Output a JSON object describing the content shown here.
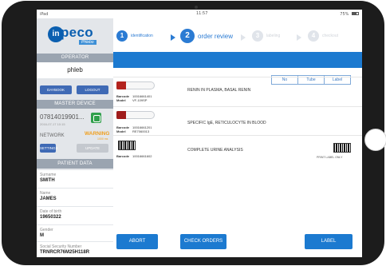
{
  "status_bar": {
    "carrier": "iPad",
    "time": "11:57",
    "battery": "75%"
  },
  "brand": {
    "logo_mark": "in",
    "logo_word": "peco",
    "logo_sub": "Phlebo"
  },
  "operator": {
    "header": "OPERATOR",
    "name": "phleb",
    "daybook_label": "DAYBOOK",
    "logout_label": "LOGOUT"
  },
  "master_device": {
    "header": "MASTER DEVICE",
    "id": "07814019901...",
    "date": "2016-07-17 10:15",
    "network_label": "NETWORK",
    "warning": "WARNING",
    "warning_sub": "1000 ms",
    "settings_label": "SETTINGS",
    "update_label": "UPDATE"
  },
  "patient": {
    "header": "PATIENT DATA",
    "fields": [
      {
        "label": "Surname",
        "value": "SMITH"
      },
      {
        "label": "Name",
        "value": "JAMES"
      },
      {
        "label": "Date of birth",
        "value": "19650322"
      },
      {
        "label": "Gender",
        "value": "M"
      },
      {
        "label": "Social Security Number",
        "value": "TRNRCR76M25H118R"
      }
    ]
  },
  "steps": [
    {
      "number": "1",
      "label": "identification"
    },
    {
      "number": "2",
      "label": "order review"
    },
    {
      "number": "3",
      "label": "labeling"
    },
    {
      "number": "4",
      "label": "checkout"
    }
  ],
  "tabs": [
    "No",
    "Tube",
    "Label"
  ],
  "orders": [
    {
      "barcode": "10016661401",
      "model": "VF-109SP",
      "name": "RENIN IN PLASMA, BASAL RENIN"
    },
    {
      "barcode": "10016661201",
      "model": "RE7060013",
      "name": "SPECIFIC IgE, RETICULOCYTE IN BLOOD"
    },
    {
      "barcode": "10016661602",
      "name": "COMPLETE URINE ANALYSIS",
      "print_label": "PRINT LABEL ONLY"
    }
  ],
  "field_labels": {
    "barcode": "Barcode",
    "model": "Model"
  },
  "actions": {
    "abort": "ABORT",
    "check_orders": "CHECK ORDERS",
    "label": "LABEL"
  },
  "colors": {
    "primary": "#1c7ad0",
    "step_active": "#2b7bd3",
    "warning": "#f0a020",
    "ok": "#2f9f4b",
    "panel": "#e3e6ea"
  }
}
